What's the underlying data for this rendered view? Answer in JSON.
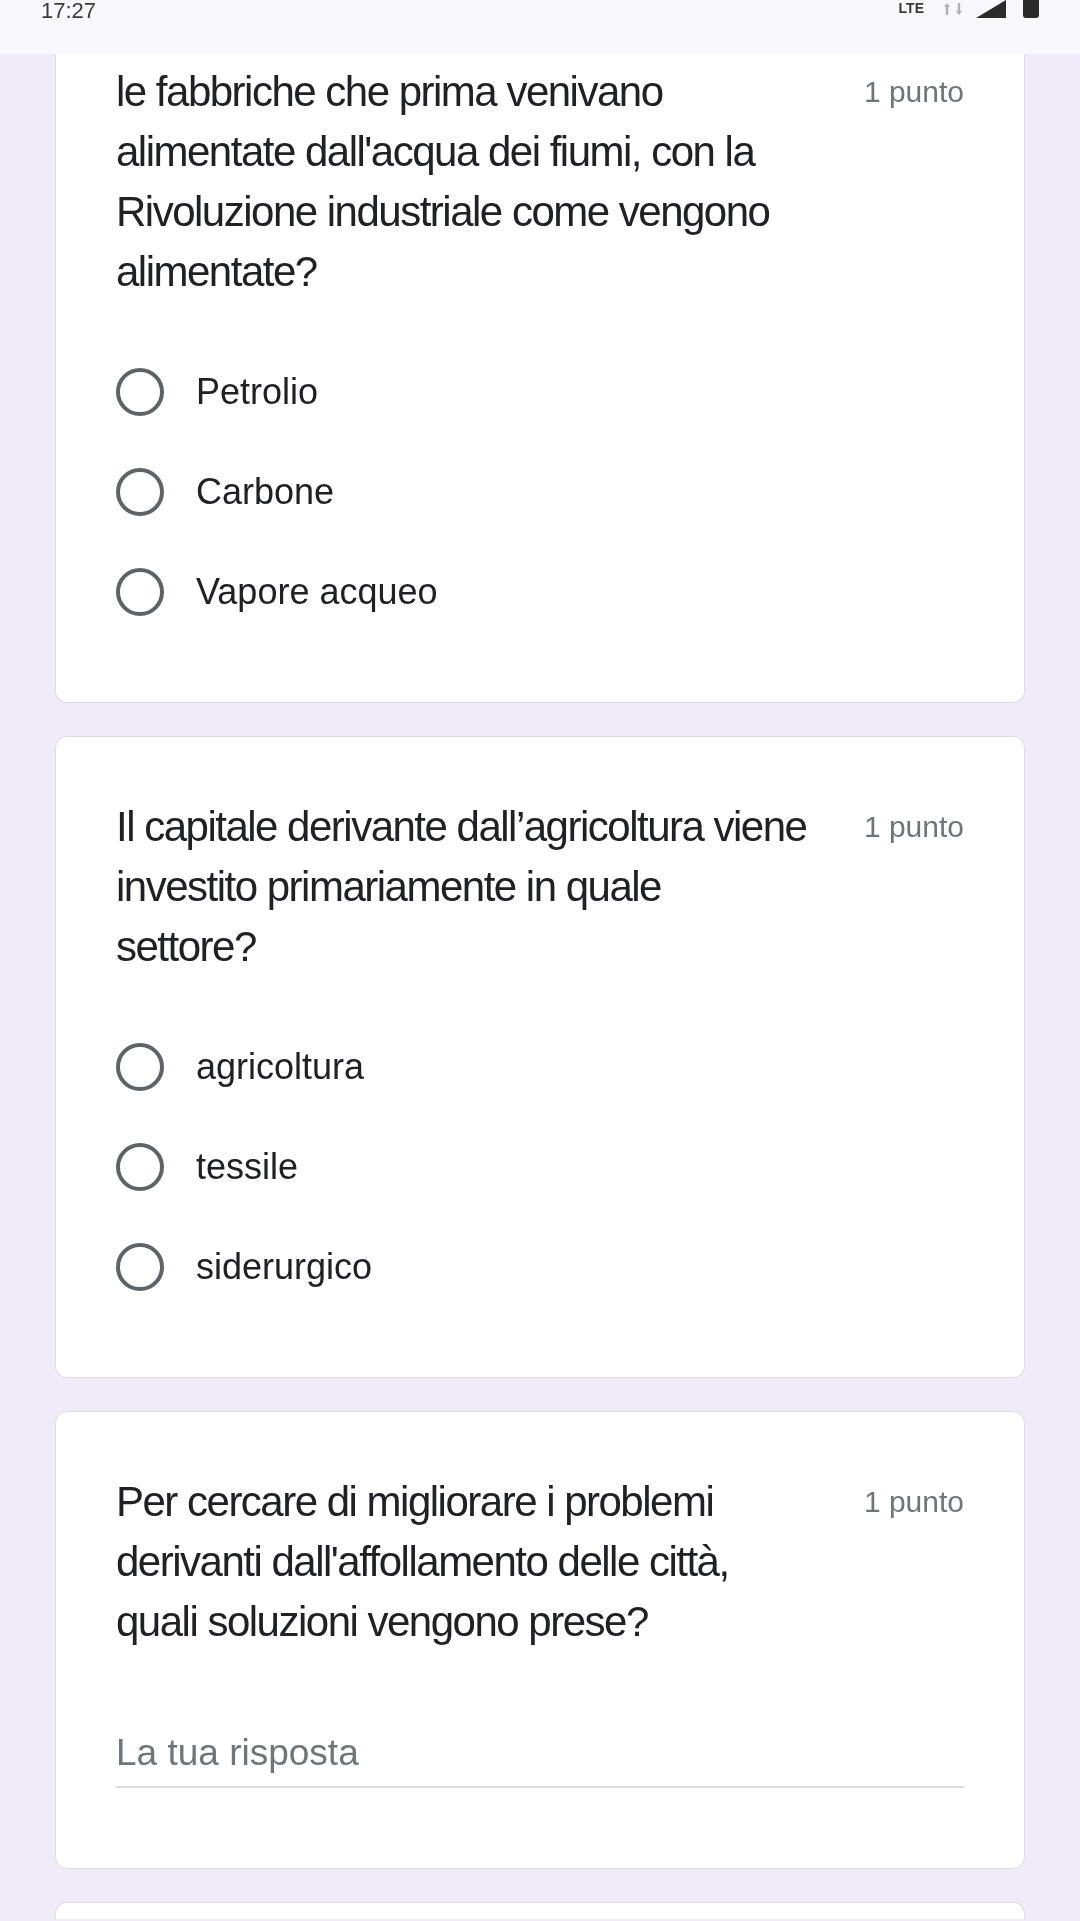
{
  "status_bar": {
    "time": "17:27",
    "network": "LTE"
  },
  "questions": [
    {
      "kind": "choice",
      "text": "le fabbriche che prima venivano alimentate dall'acqua dei fiumi, con la Rivoluzione industriale come vengono alimentate?",
      "points": "1 punto",
      "options": [
        {
          "label": "Petrolio",
          "selected": false
        },
        {
          "label": "Carbone",
          "selected": false
        },
        {
          "label": "Vapore acqueo",
          "selected": false
        }
      ]
    },
    {
      "kind": "choice",
      "text": "Il capitale derivante dall’agricoltura viene investito primariamente in quale settore?",
      "points": "1 punto",
      "options": [
        {
          "label": "agricoltura",
          "selected": false
        },
        {
          "label": "tessile",
          "selected": false
        },
        {
          "label": "siderurgico",
          "selected": false
        }
      ]
    },
    {
      "kind": "short_answer",
      "text": "Per cercare di migliorare i problemi derivanti dall'affollamento delle città, quali soluzioni vengono prese?",
      "points": "1 punto",
      "placeholder": "La tua risposta"
    }
  ]
}
